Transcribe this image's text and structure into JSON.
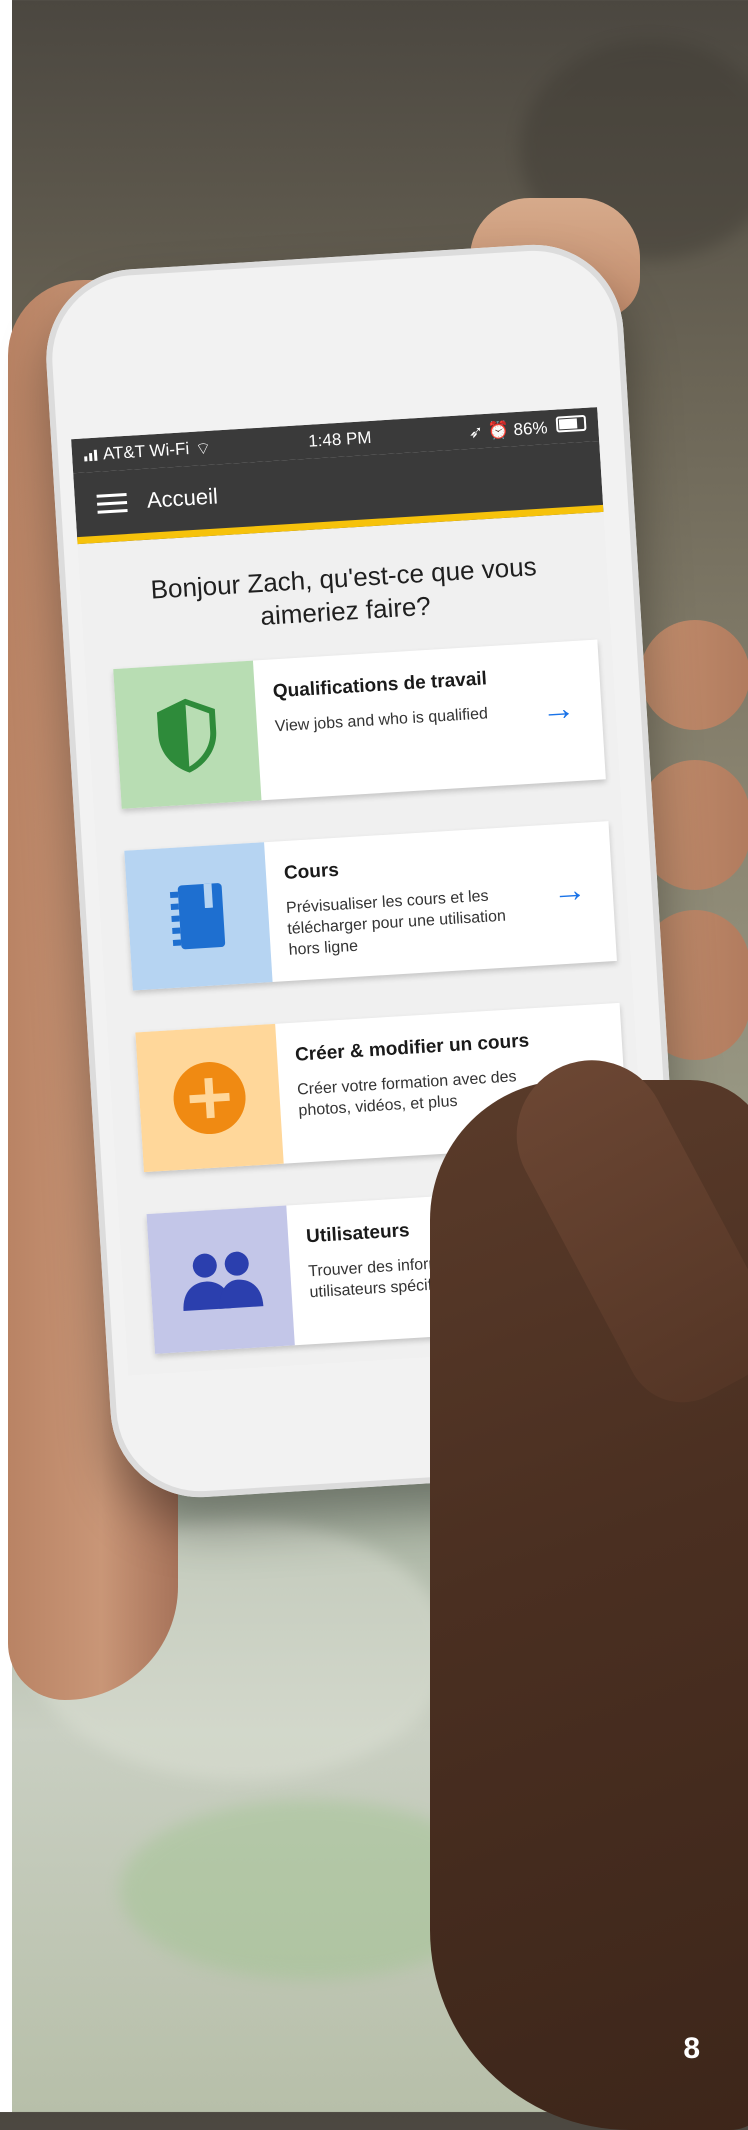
{
  "status_bar": {
    "carrier": "AT&T Wi-Fi",
    "time": "1:48 PM",
    "battery": "86%"
  },
  "header": {
    "title": "Accueil"
  },
  "greeting": "Bonjour Zach, qu'est-ce que vous aimeriez faire?",
  "cards": [
    {
      "title": "Qualifications de travail",
      "desc": "View jobs and who is qualified",
      "icon": "shield-icon",
      "color": "#b8ddb3",
      "icon_color": "#2e8b3a"
    },
    {
      "title": "Cours",
      "desc": "Prévisualiser les cours et les télécharger pour une utilisation hors ligne",
      "icon": "book-icon",
      "color": "#b6d4f2",
      "icon_color": "#1e6fd0"
    },
    {
      "title": "Créer & modifier un cours",
      "desc": "Créer votre formation avec des photos, vidéos, et plus",
      "icon": "add-circle-icon",
      "color": "#ffd79a",
      "icon_color": "#f08a12"
    },
    {
      "title": "Utilisateurs",
      "desc": "Trouver des informations sur des utilisateurs spécifiques",
      "icon": "users-icon",
      "color": "#c3c6e8",
      "icon_color": "#2b3fae"
    }
  ],
  "arrow_glyph": "→",
  "page_number": "8"
}
